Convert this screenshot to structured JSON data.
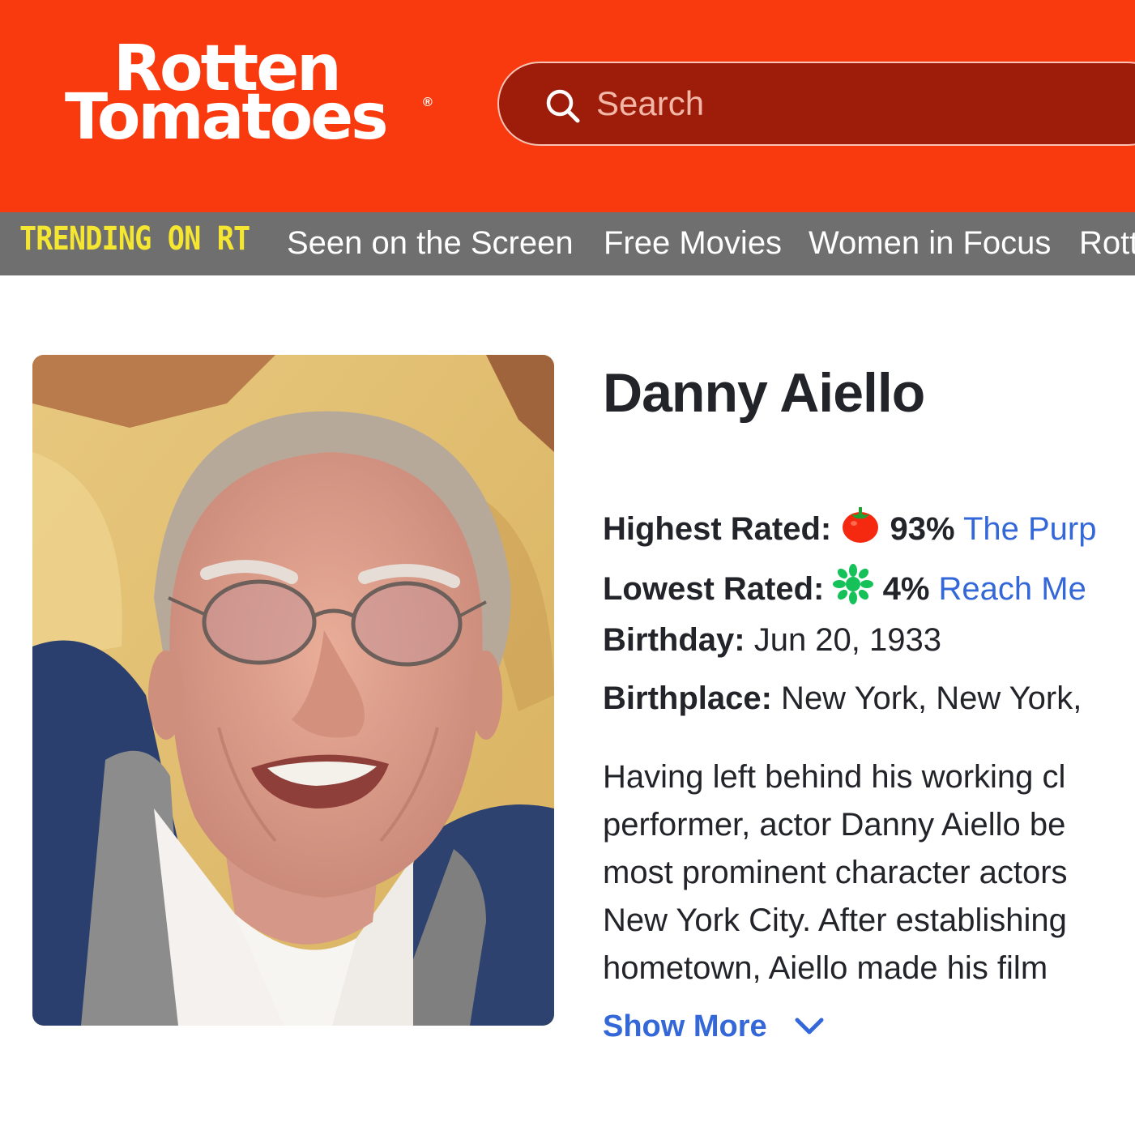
{
  "header": {
    "logo_line1": "Rotten",
    "logo_line2": "Tomatoes",
    "logo_mark": "®",
    "search_placeholder": "Search",
    "brand_color": "#f93a0e"
  },
  "trending": {
    "label": "TRENDING ON RT",
    "links": [
      "Seen on the Screen",
      "Free Movies",
      "Women in Focus",
      "Rott"
    ]
  },
  "celebrity": {
    "name": "Danny Aiello",
    "photo_icon": "portrait-photo",
    "highest_rated": {
      "label": "Highest Rated:",
      "icon": "fresh-tomato-icon",
      "score": "93%",
      "title": "The Purp"
    },
    "lowest_rated": {
      "label": "Lowest Rated:",
      "icon": "rotten-splat-icon",
      "score": "4%",
      "title": "Reach Me"
    },
    "birthday": {
      "label": "Birthday:",
      "value": " Jun 20, 1933"
    },
    "birthplace": {
      "label": "Birthplace:",
      "value": " New York, New York,"
    },
    "bio_lines": [
      "Having left behind his working cl",
      "performer, actor Danny Aiello be",
      "most prominent character actors",
      "New York City. After establishing",
      "hometown, Aiello made his film"
    ],
    "show_more": "Show More"
  },
  "colors": {
    "link_blue": "#3467d8",
    "trending_yellow": "#f5e632",
    "search_bg": "#9e1d0a",
    "tomato_red": "#f5290f",
    "splat_green": "#17c15a"
  }
}
